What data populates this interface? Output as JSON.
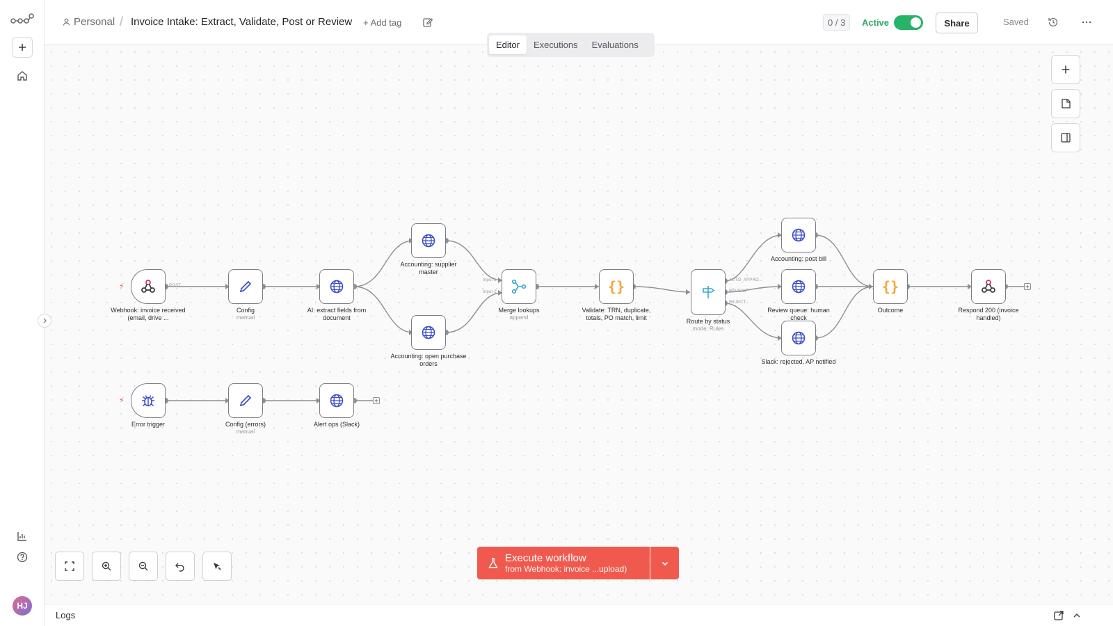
{
  "rail": {
    "avatar_initials": "HJ",
    "icons": [
      "n8n-logo-icon",
      "plus-icon",
      "home-icon",
      "insights-icon",
      "help-icon",
      "chevron-right-icon"
    ]
  },
  "header": {
    "project": "Personal",
    "workflow_title": "Invoice Intake: Extract, Validate, Post or Review",
    "add_tag": "+ Add tag",
    "counter": "0 / 3",
    "active_label": "Active",
    "active": true,
    "share": "Share",
    "saved": "Saved"
  },
  "tabs": [
    {
      "label": "Editor",
      "active": true
    },
    {
      "label": "Executions",
      "active": false
    },
    {
      "label": "Evaluations",
      "active": false
    }
  ],
  "nodes": {
    "webhook": {
      "label": "Webhook: invoice received (email, drive ...",
      "icon": "webhook-icon"
    },
    "config": {
      "label": "Config",
      "sub": "manual",
      "icon": "pencil-icon"
    },
    "ai_extract": {
      "label": "AI: extract fields from document",
      "icon": "globe-icon"
    },
    "supplier": {
      "label": "Accounting: supplier master",
      "icon": "globe-icon"
    },
    "open_po": {
      "label": "Accounting: open purchase orders",
      "icon": "globe-icon"
    },
    "merge": {
      "label": "Merge lookups",
      "sub": "append",
      "icon": "merge-icon"
    },
    "validate": {
      "label": "Validate: TRN, duplicate, totals, PO match, limit",
      "icon": "code-icon"
    },
    "route": {
      "label": "Route by status",
      "sub": "mode: Rules",
      "icon": "signpost-icon"
    },
    "post_bill": {
      "label": "Accounting: post bill",
      "icon": "globe-icon"
    },
    "review_queue": {
      "label": "Review queue: human check",
      "icon": "globe-icon"
    },
    "slack_rejected": {
      "label": "Slack: rejected, AP notified",
      "icon": "globe-icon"
    },
    "outcome": {
      "label": "Outcome",
      "icon": "code-icon"
    },
    "respond": {
      "label": "Respond 200 (invoice handled)",
      "icon": "webhook-icon"
    },
    "error_trigger": {
      "label": "Error trigger",
      "icon": "bug-icon"
    },
    "config_errors": {
      "label": "Config (errors)",
      "sub": "manual",
      "icon": "pencil-icon"
    },
    "alert_ops": {
      "label": "Alert ops (Slack)",
      "icon": "globe-icon"
    }
  },
  "ports": {
    "post": "POST",
    "input1": "Input 1",
    "input2": "Input 2",
    "auto_approve": "AUTO_APPRO...",
    "review": "REVIEW",
    "reject": "REJECT"
  },
  "execute": {
    "label": "Execute workflow",
    "sub": "from Webhook: invoice ...upload)"
  },
  "logs": {
    "label": "Logs"
  },
  "colors": {
    "accent": "#f05a4e",
    "active_green": "#27b368",
    "globe_blue": "#3c4fc4",
    "code_orange": "#f2a53a",
    "route_cyan": "#39a8c9"
  }
}
